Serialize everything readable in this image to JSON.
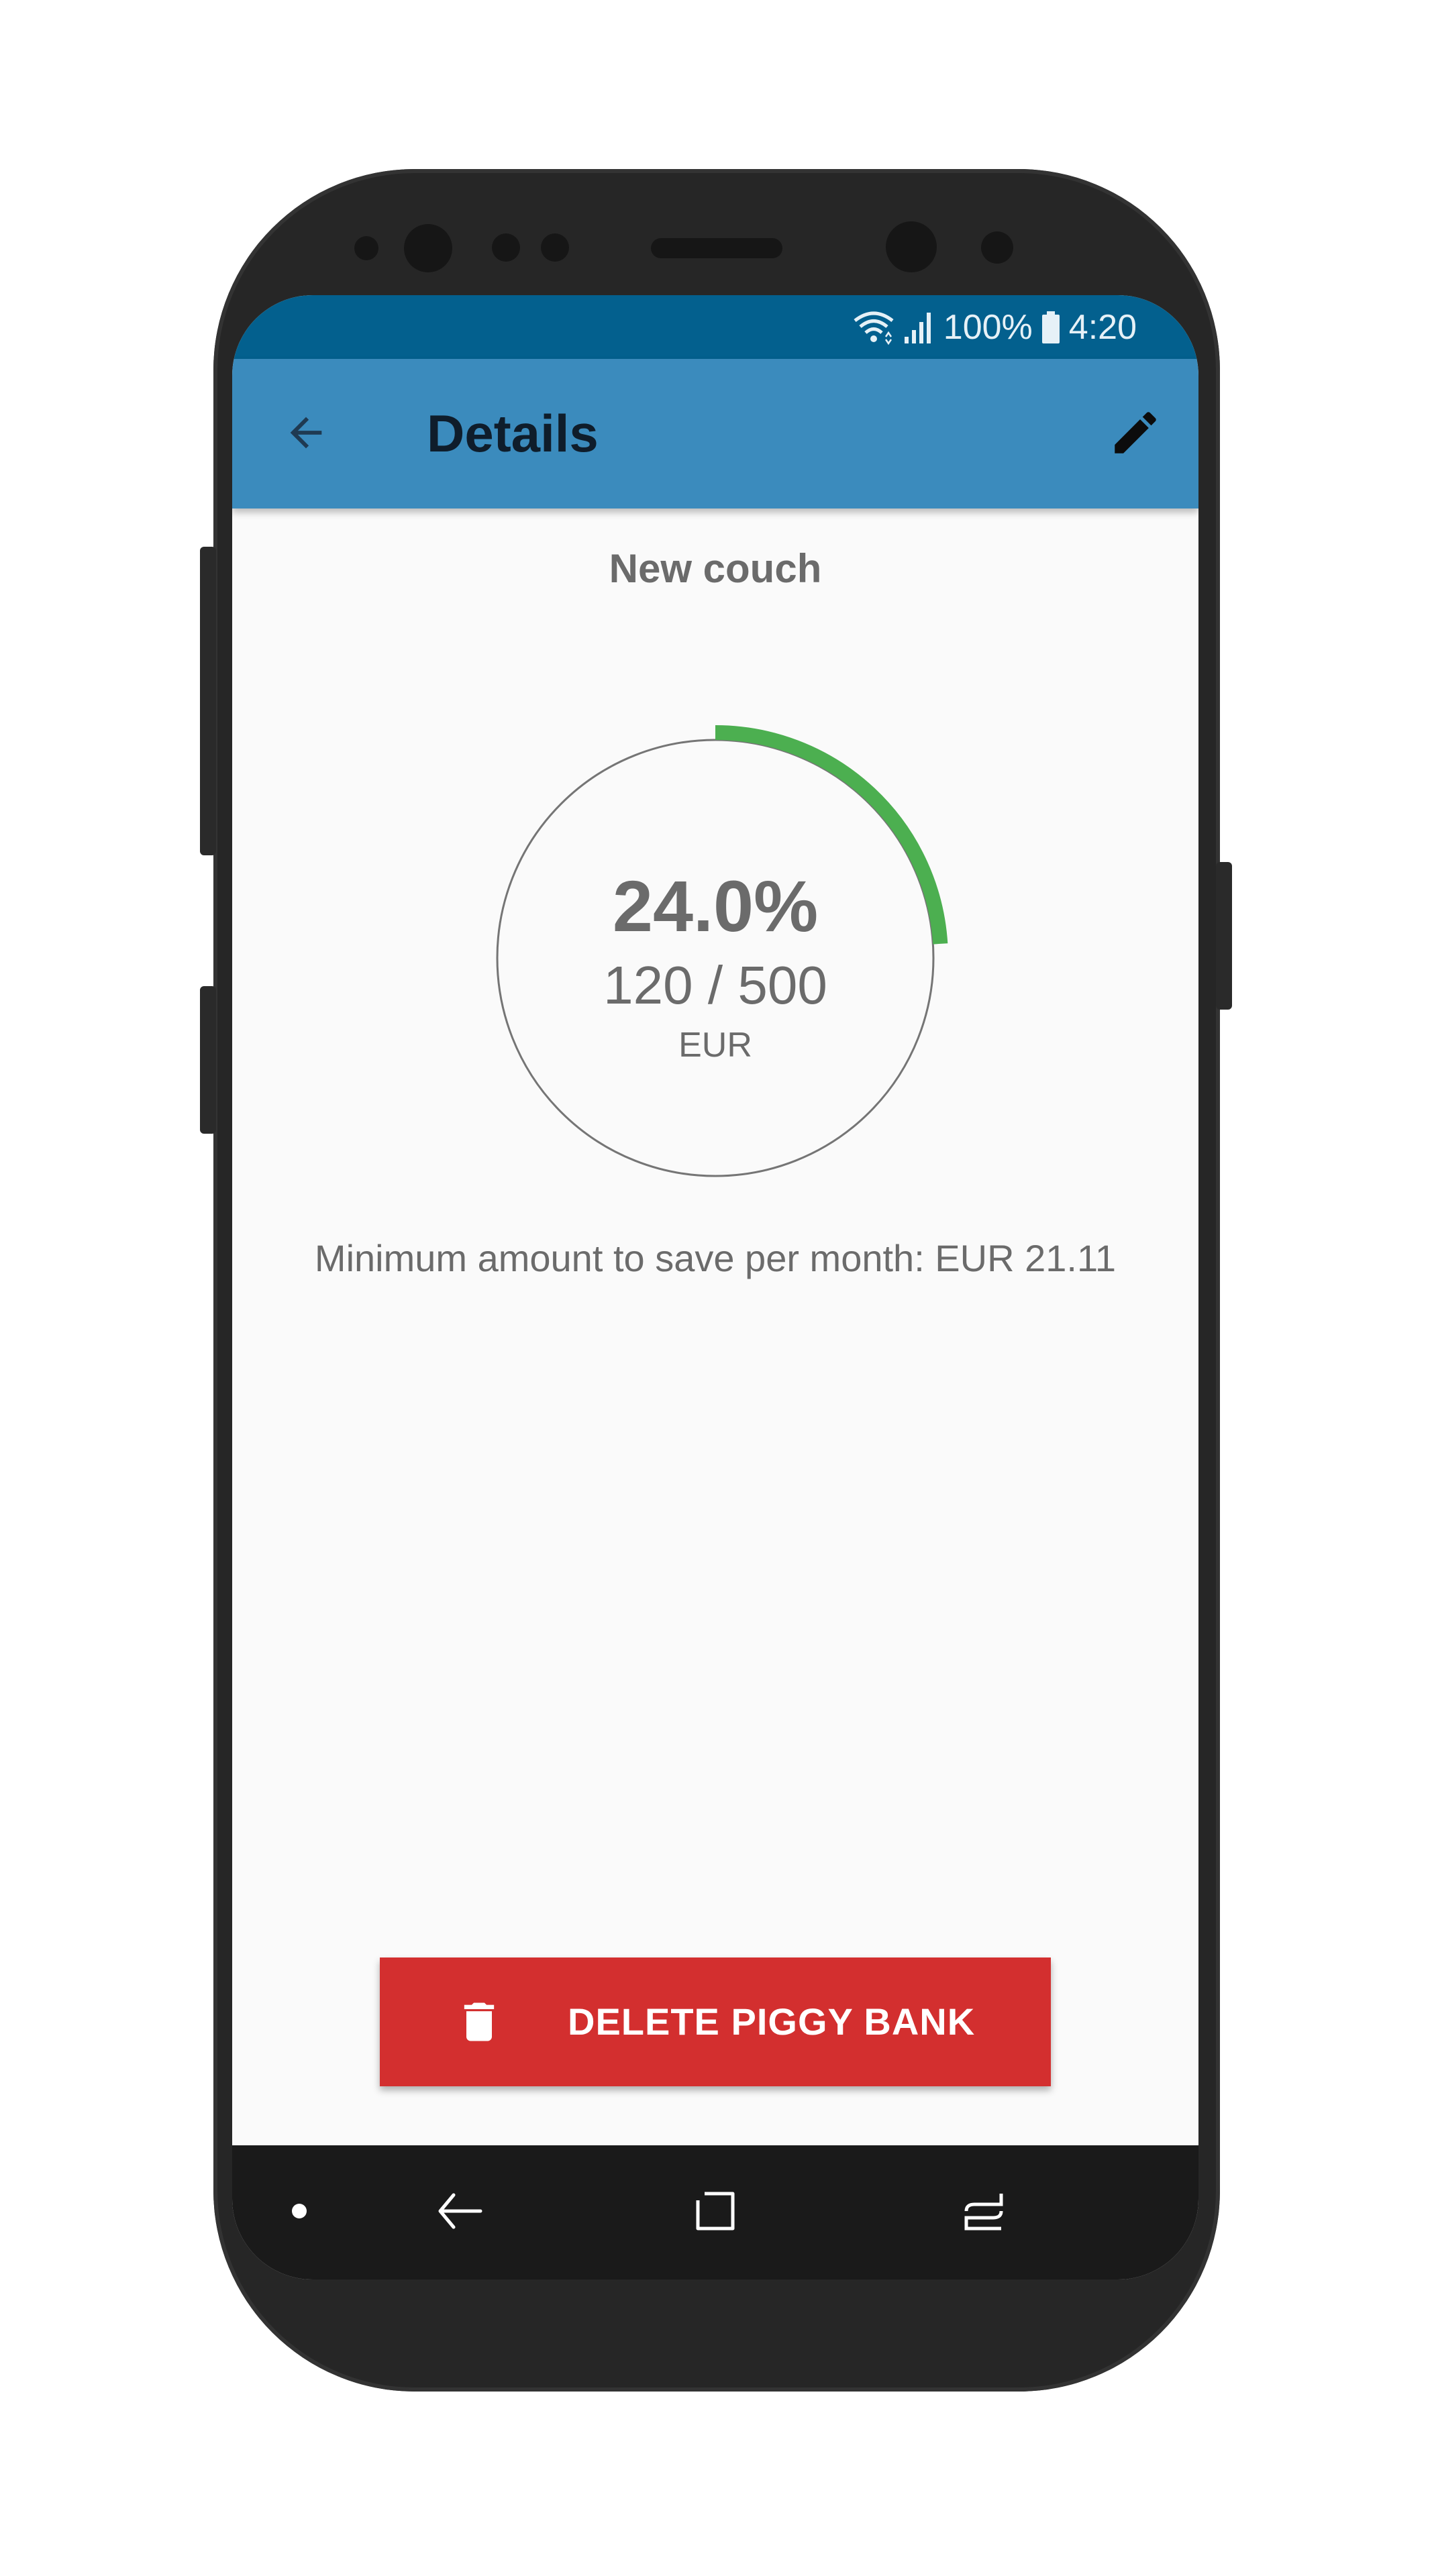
{
  "status_bar": {
    "battery": "100%",
    "time": "4:20"
  },
  "app_bar": {
    "title": "Details",
    "back_icon": "arrow-left-icon",
    "edit_icon": "pencil-icon"
  },
  "piggy_bank": {
    "name": "New couch",
    "progress_percent_label": "24.0%",
    "progress_fraction": 0.24,
    "amount_label": "120 / 500",
    "currency": "EUR",
    "min_save_text": "Minimum amount to save per month: EUR 21.11"
  },
  "actions": {
    "delete_label": "DELETE PIGGY BANK",
    "delete_icon": "trash-icon"
  },
  "colors": {
    "status_bar": "#03608e",
    "app_bar": "#3b8bbd",
    "progress": "#4caf50",
    "delete": "#d32f2f"
  },
  "nav_bar": {
    "icons": [
      "dot-icon",
      "back-icon",
      "recents-icon",
      "switch-icon"
    ]
  }
}
